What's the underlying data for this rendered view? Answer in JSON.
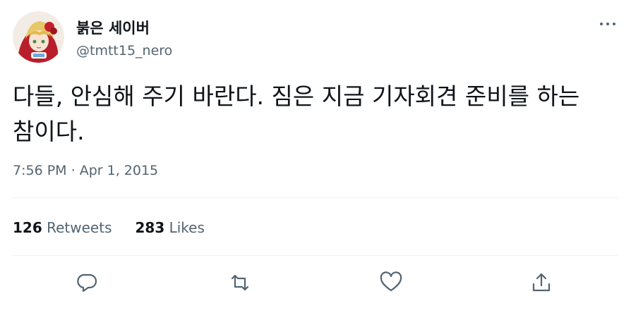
{
  "user": {
    "display_name": "붉은 세이버",
    "handle": "@tmtt15_nero"
  },
  "tweet": {
    "text": "다들, 안심해 주기 바란다. 짐은 지금 기자회견 준비를 하는 참이다.",
    "time": "7:56 PM",
    "separator": "·",
    "date": "Apr 1, 2015"
  },
  "stats": {
    "retweets_count": "126",
    "retweets_label": "Retweets",
    "likes_count": "283",
    "likes_label": "Likes"
  },
  "icons": {
    "more": "more-dots-icon",
    "reply": "reply-icon",
    "retweet": "retweet-icon",
    "like": "heart-icon",
    "share": "share-icon"
  },
  "colors": {
    "text_primary": "#0f1419",
    "text_secondary": "#536471",
    "divider": "#eff3f4"
  }
}
